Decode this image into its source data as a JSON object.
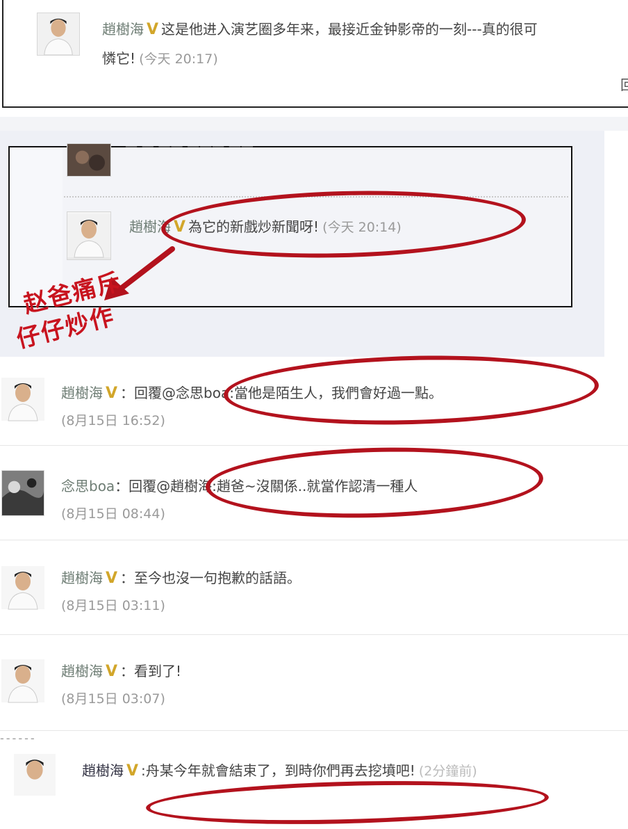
{
  "top_card": {
    "user": "趙樹海",
    "badge": "V",
    "message_line1": "这是他进入演艺圈多年来，最接近金钟影帝的一刻---真的很可",
    "message_line2": "憐它!",
    "time": "(今天 20:17)",
    "corner": "回"
  },
  "boxed_card": {
    "top_blurred_text": "— —  —— ———  ——",
    "user": "趙樹海",
    "badge": "V",
    "message": "為它的新戲炒新聞呀!",
    "time": "(今天 20:14)"
  },
  "annotation": {
    "line1": "赵爸痛斥",
    "line2": "仔仔炒作"
  },
  "comments": [
    {
      "user": "趙樹海",
      "badge": "V",
      "text": "：回覆@念思boa:當他是陌生人，我們會好過一點。",
      "time": "(8月15日 16:52)"
    },
    {
      "user": "念思boa",
      "badge": "",
      "text": "：回覆@趙樹海:趙爸~沒關係..就當作認清一種人",
      "time": "(8月15日 08:44)"
    },
    {
      "user": "趙樹海",
      "badge": "V",
      "text": "：至今也沒一句抱歉的話語。",
      "time": "(8月15日 03:11)"
    },
    {
      "user": "趙樹海",
      "badge": "V",
      "text": "：看到了!",
      "time": "(8月15日 03:07)"
    }
  ],
  "bottom_card": {
    "divider_text": "------",
    "user": "趙樹海",
    "badge": "V",
    "message": ":舟某今年就會結束了，到時你們再去挖墳吧!",
    "time": "(2分鐘前)"
  },
  "colors": {
    "annotation_red": "#b3121d",
    "badge_gold": "#d2a62a",
    "name_gray": "#6e7d74"
  }
}
